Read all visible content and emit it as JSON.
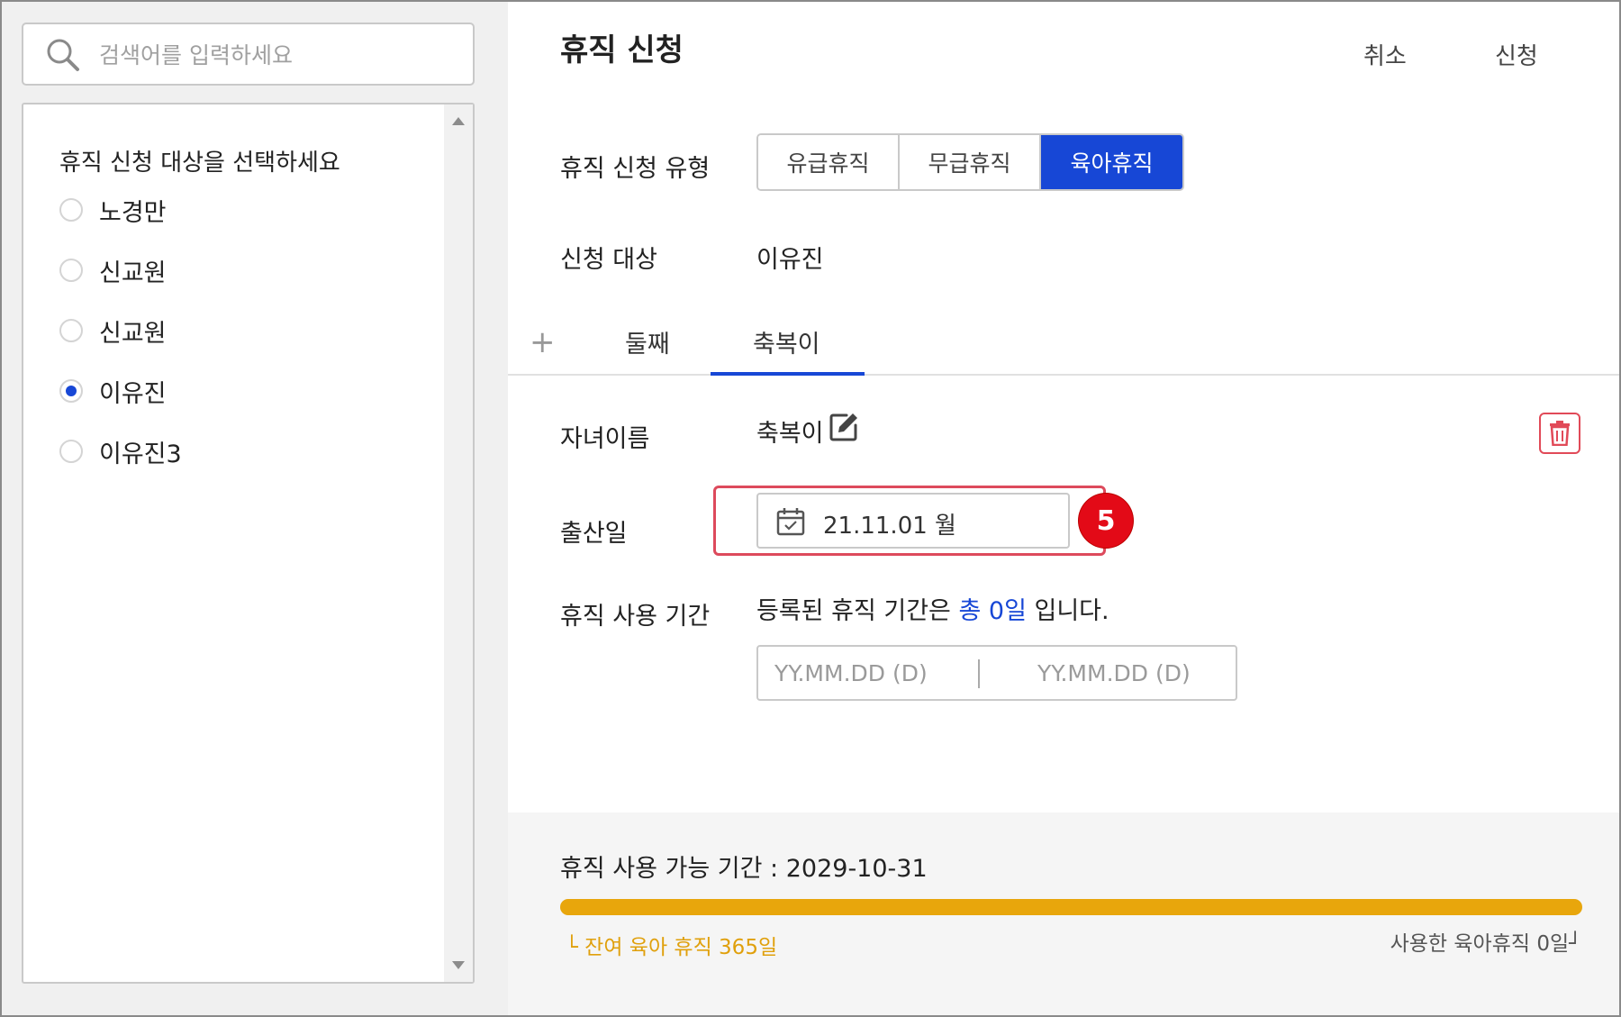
{
  "search": {
    "placeholder": "검색어를 입력하세요"
  },
  "target_list": {
    "title": "휴직 신청 대상을 선택하세요",
    "items": [
      {
        "label": "노경만",
        "checked": false
      },
      {
        "label": "신교원",
        "checked": false
      },
      {
        "label": "신교원",
        "checked": false
      },
      {
        "label": "이유진",
        "checked": true
      },
      {
        "label": "이유진3",
        "checked": false
      }
    ]
  },
  "header": {
    "title": "휴직 신청",
    "cancel_label": "취소",
    "submit_label": "신청"
  },
  "form": {
    "type_label": "휴직 신청 유형",
    "types": [
      "유급휴직",
      "무급휴직",
      "육아휴직"
    ],
    "selected_type": "육아휴직",
    "target_label": "신청 대상",
    "target_value": "이유진"
  },
  "child_tabs": {
    "add_icon": "plus-icon",
    "tabs": [
      "둘째",
      "축복이"
    ],
    "active_tab": "축복이"
  },
  "child": {
    "name_label": "자녀이름",
    "name_value": "축복이",
    "birth_label": "출산일",
    "birth_value": "21.11.01 월",
    "step_badge": "5",
    "period_label": "휴직 사용 기간",
    "period_msg_prefix": "등록된 휴직 기간은 ",
    "period_msg_total": "총 0일",
    "period_msg_suffix": " 입니다.",
    "start_placeholder": "YY.MM.DD (D)",
    "end_placeholder": "YY.MM.DD (D)"
  },
  "footer": {
    "available_label": "휴직 사용 가능 기간 : 2029-10-31",
    "remaining_text": "└ 잔여 육아 휴직 365일",
    "used_text": "사용한 육아휴직 0일┘",
    "remaining_fraction": 1.0
  },
  "colors": {
    "accent": "#1747d6",
    "highlight": "#dd4a5c",
    "badge": "#e30a17",
    "bar": "#e8a60c",
    "delete": "#e14a58"
  }
}
